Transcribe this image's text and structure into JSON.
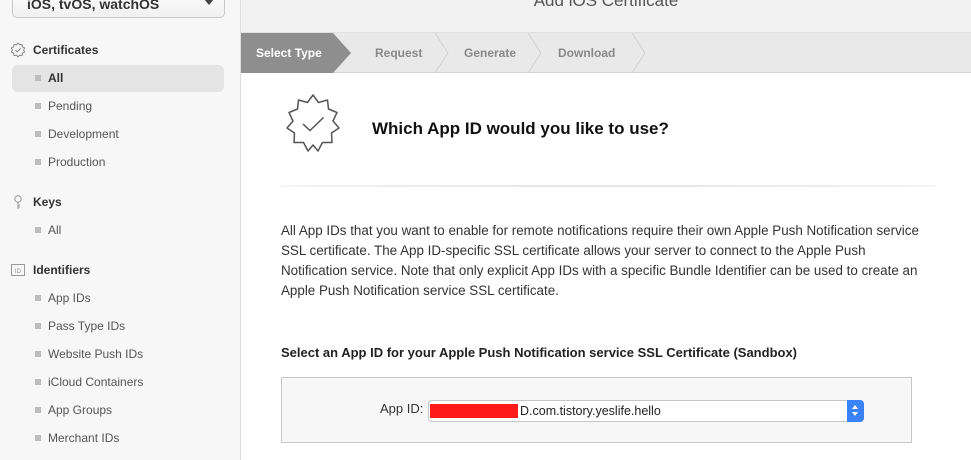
{
  "sidebar": {
    "platform_select": "iOS, tvOS, watchOS",
    "sections": [
      {
        "title": "Certificates",
        "icon": "certificate-badge-icon",
        "items": [
          "All",
          "Pending",
          "Development",
          "Production"
        ],
        "active": "All"
      },
      {
        "title": "Keys",
        "icon": "key-icon",
        "items": [
          "All"
        ]
      },
      {
        "title": "Identifiers",
        "icon": "id-card-icon",
        "id_glyph": "ID",
        "items": [
          "App IDs",
          "Pass Type IDs",
          "Website Push IDs",
          "iCloud Containers",
          "App Groups",
          "Merchant IDs"
        ]
      }
    ]
  },
  "main": {
    "page_title": "Add iOS Certificate",
    "steps": [
      {
        "label": "Select Type",
        "active": true
      },
      {
        "label": "Request",
        "active": false
      },
      {
        "label": "Generate",
        "active": false
      },
      {
        "label": "Download",
        "active": false
      }
    ],
    "question": "Which App ID would you like to use?",
    "description": "All App IDs that you want to enable for remote notifications require their own Apple Push Notification service SSL certificate. The App ID-specific SSL certificate allows your server to connect to the Apple Push Notification service. Note that only explicit App IDs with a specific Bundle Identifier can be used to create an Apple Push Notification service SSL certificate.",
    "select_heading": "Select an App ID for your Apple Push Notification service SSL Certificate (Sandbox)",
    "app_id": {
      "label": "App ID:",
      "value": "D.com.tistory.yeslife.hello",
      "value_visible": ".com.tistory.yeslife.hello",
      "redacted": true
    }
  },
  "colors": {
    "active_step_bg": "#8e8e8e",
    "step_bar_bg": "#e9e9e9",
    "select_stepper": "#3a82f7",
    "redaction": "#ff1a1a",
    "sidebar_bg": "#f7f7f7"
  }
}
